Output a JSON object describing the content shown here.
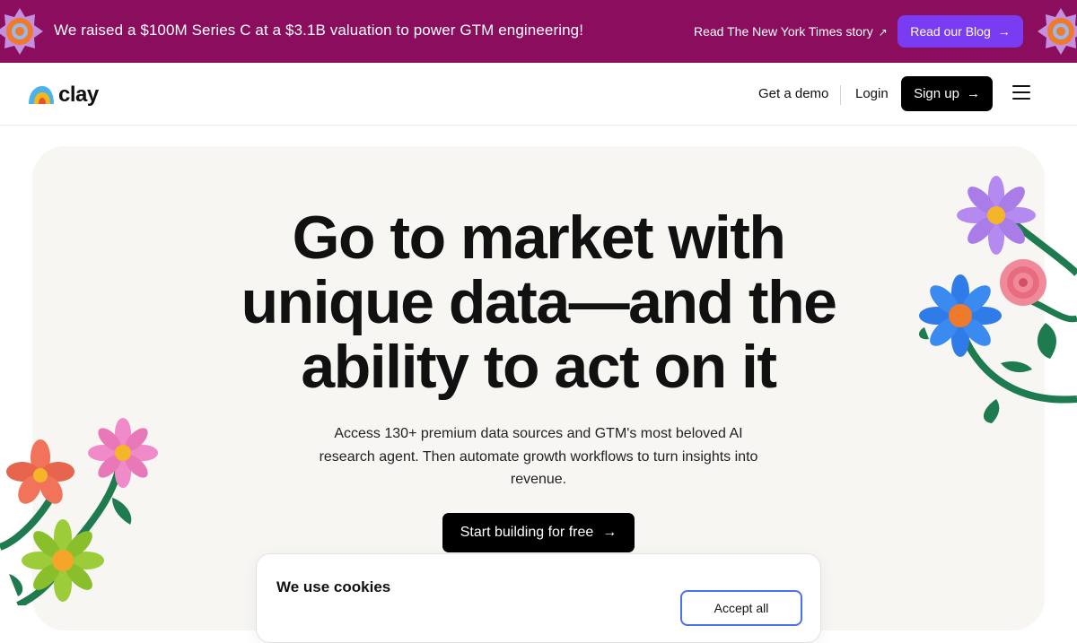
{
  "banner": {
    "announcement": "We raised a $100M Series C at a $3.1B valuation to power GTM engineering!",
    "story_link": "Read The New York Times story",
    "story_icon": "arrow-up-right-icon",
    "blog_button": "Read our Blog",
    "blog_icon": "arrow-right-icon",
    "background_color": "#8a0d5e",
    "button_color": "#7a3cf2"
  },
  "nav": {
    "logo_text": "clay",
    "get_demo": "Get a demo",
    "login": "Login",
    "signup": "Sign up",
    "signup_icon": "arrow-right-icon",
    "menu_icon": "hamburger-menu-icon"
  },
  "hero": {
    "headline_line1": "Go to market with",
    "headline_line2": "unique data—and the",
    "headline_line3": "ability to act on it",
    "subtext": "Access 130+ premium data sources and GTM's most beloved AI research agent. Then automate growth workflows to turn insights into revenue.",
    "cta": "Start building for free",
    "cta_icon": "arrow-right-icon",
    "background_color": "#f7f6f3"
  },
  "cookie": {
    "title": "We use cookies",
    "button_label": "Accept all"
  }
}
